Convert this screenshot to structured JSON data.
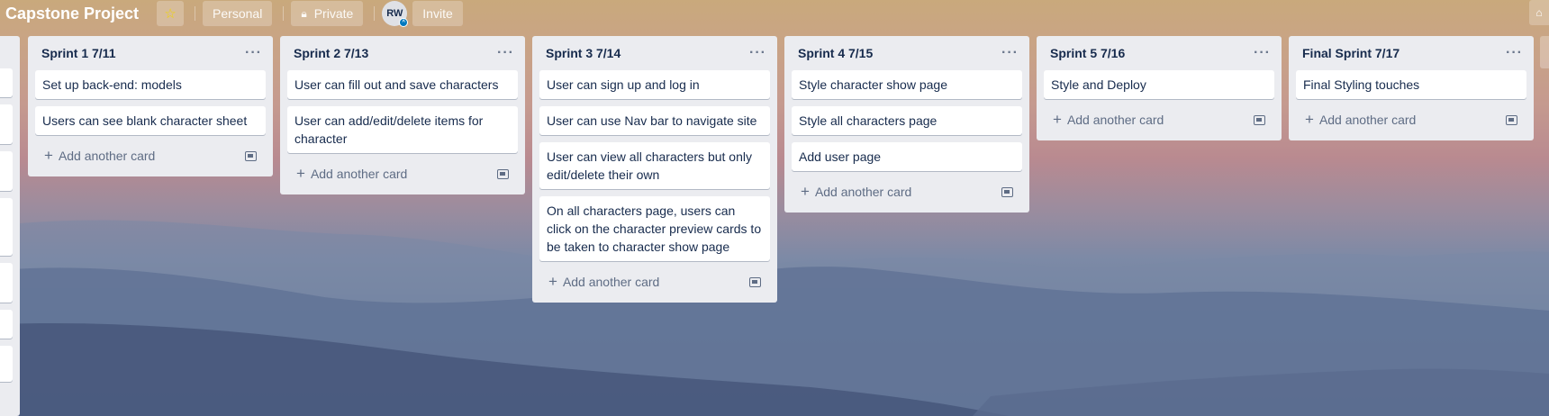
{
  "header": {
    "board_title": "Capstone Project",
    "star_icon": "star-icon",
    "workspace_label": "Personal",
    "visibility_label": "Private",
    "visibility_icon": "lock-icon",
    "avatar_initials": "RW",
    "invite_label": "Invite",
    "star_color": "#f2d600"
  },
  "add_card_label": "Add another card",
  "lists": [
    {
      "title": "Sprint 1 7/11",
      "cards": [
        "Set up back-end: models",
        "Users can see blank character sheet"
      ]
    },
    {
      "title": "Sprint 2 7/13",
      "cards": [
        "User can fill out and save characters",
        "User can add/edit/delete items for character"
      ]
    },
    {
      "title": "Sprint 3 7/14",
      "cards": [
        "User can sign up and log in",
        "User can use Nav bar to navigate site",
        "User can view all characters but only edit/delete their own",
        "On all characters page, users can click on the character preview cards to be taken to character show page"
      ]
    },
    {
      "title": "Sprint 4 7/15",
      "cards": [
        "Style character show page",
        "Style all characters page",
        "Add user page"
      ]
    },
    {
      "title": "Sprint 5 7/16",
      "cards": [
        "Style and Deploy"
      ]
    },
    {
      "title": "Final Sprint 7/17",
      "cards": [
        "Final Styling touches"
      ]
    }
  ],
  "colors": {
    "list_bg": "#ebecf0",
    "card_bg": "#ffffff",
    "text": "#172b4d",
    "muted": "#5e6c84"
  }
}
